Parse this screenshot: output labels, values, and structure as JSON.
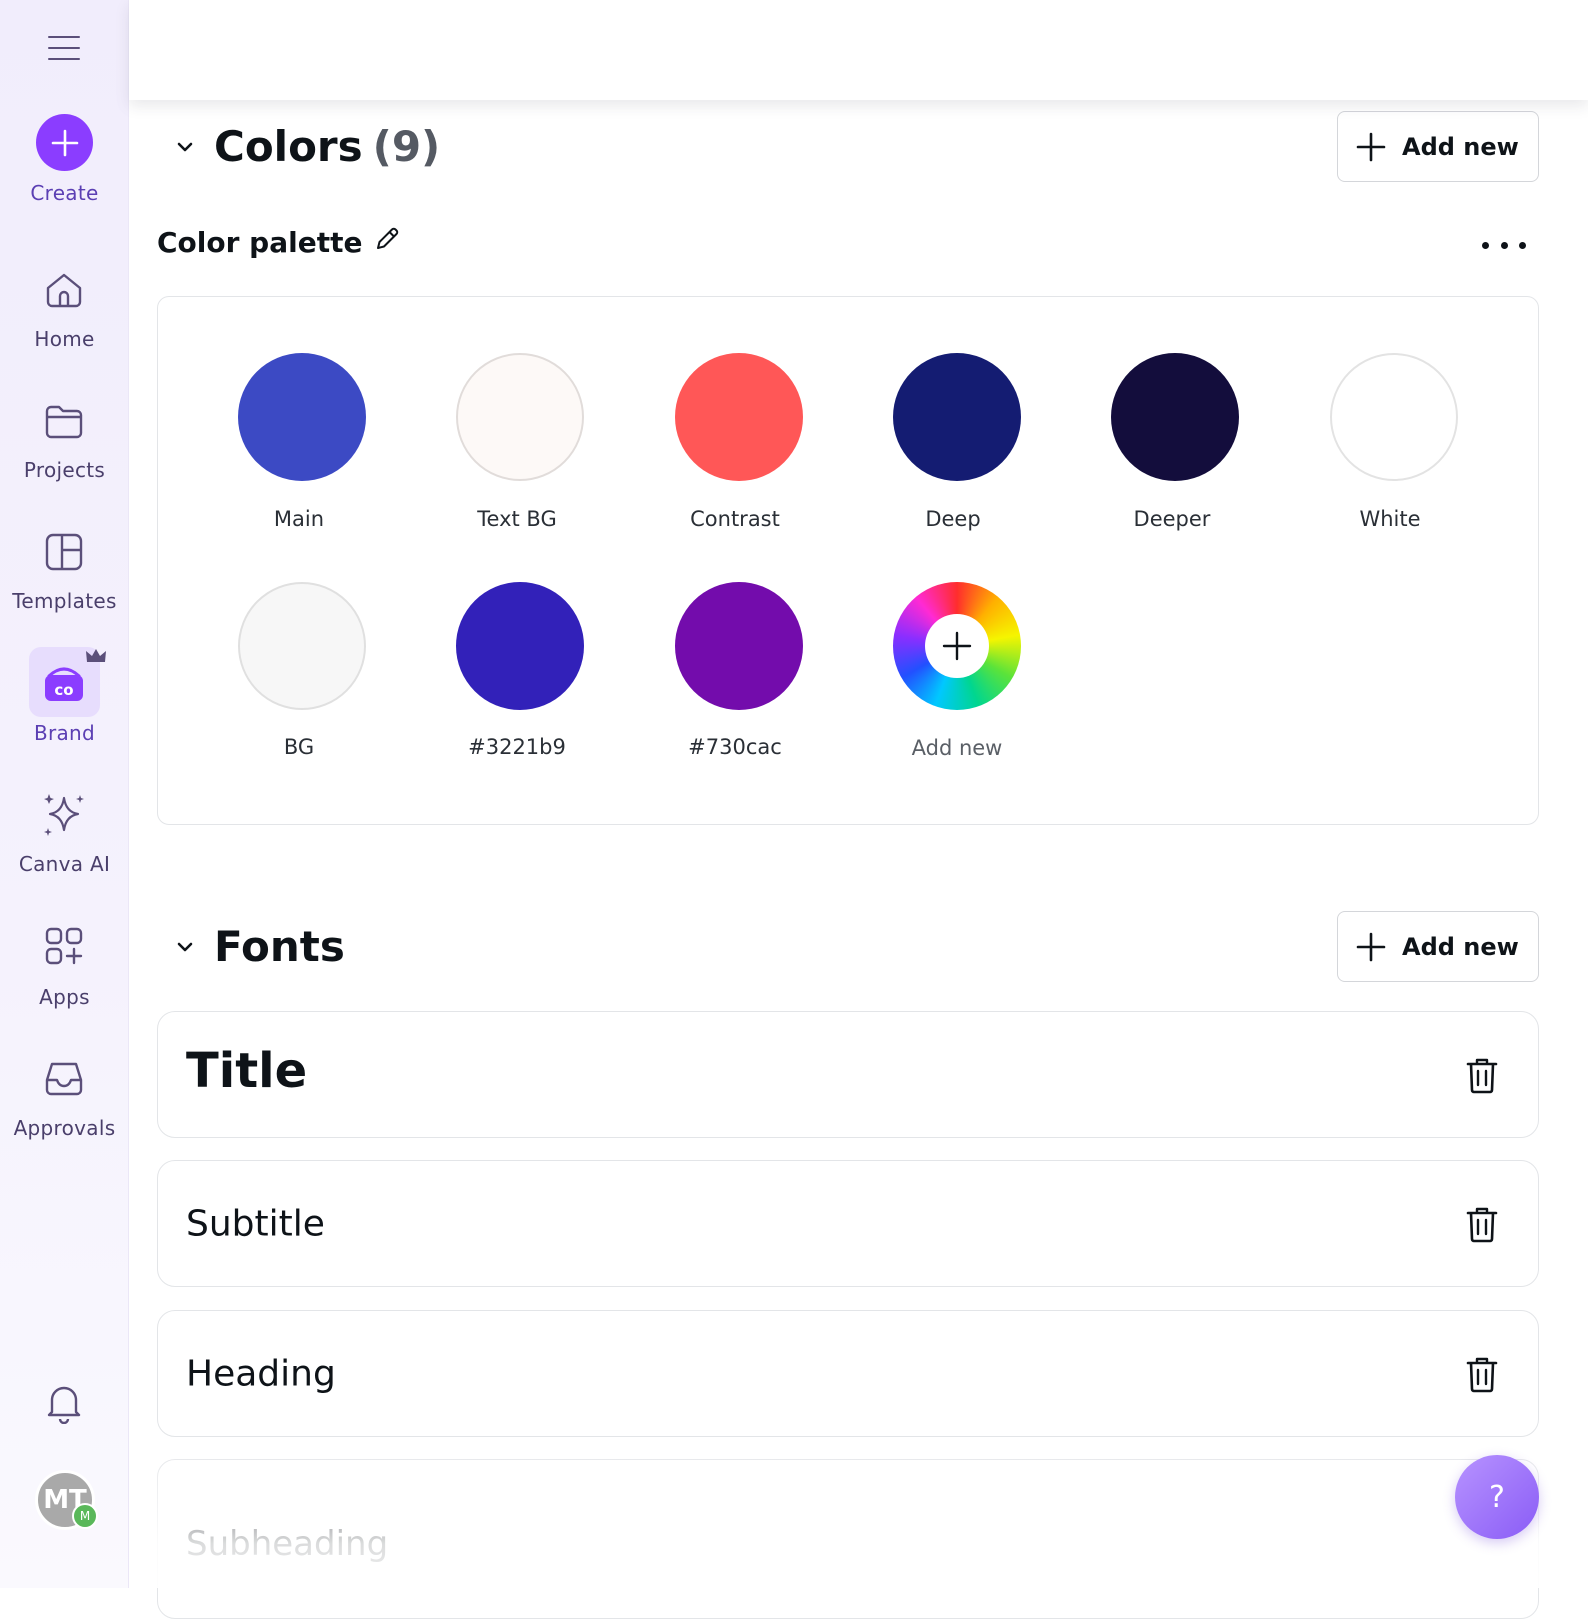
{
  "sidebar": {
    "create_label": "Create",
    "items": [
      {
        "id": "home",
        "label": "Home"
      },
      {
        "id": "projects",
        "label": "Projects"
      },
      {
        "id": "templates",
        "label": "Templates"
      },
      {
        "id": "brand",
        "label": "Brand",
        "active": true
      },
      {
        "id": "canva-ai",
        "label": "Canva AI"
      },
      {
        "id": "apps",
        "label": "Apps"
      },
      {
        "id": "approvals",
        "label": "Approvals"
      }
    ],
    "brand_logo_text": "co",
    "avatar_initials": "MT",
    "avatar_badge": "M"
  },
  "colors_section": {
    "title": "Colors",
    "count": "(9)",
    "add_label": "Add new",
    "palette_title": "Color palette",
    "swatches": [
      {
        "label": "Main",
        "color": "#3c4ac4"
      },
      {
        "label": "Text BG",
        "color": "#fdf9f7"
      },
      {
        "label": "Contrast",
        "color": "#ff5757"
      },
      {
        "label": "Deep",
        "color": "#141c72"
      },
      {
        "label": "Deeper",
        "color": "#130d3c"
      },
      {
        "label": "White",
        "color": "#ffffff"
      },
      {
        "label": "BG",
        "color": "#f7f7f7"
      },
      {
        "label": "#3221b9",
        "color": "#3221b9"
      },
      {
        "label": "#730cac",
        "color": "#730cac"
      }
    ],
    "add_swatch_label": "Add new"
  },
  "fonts_section": {
    "title": "Fonts",
    "add_label": "Add new",
    "items": [
      {
        "label": "Title"
      },
      {
        "label": "Subtitle"
      },
      {
        "label": "Heading"
      },
      {
        "label": "Subheading"
      }
    ]
  },
  "help_label": "?",
  "colors": {
    "accent": "#8b3dff",
    "sidebar_bg": "#f1edfc"
  }
}
